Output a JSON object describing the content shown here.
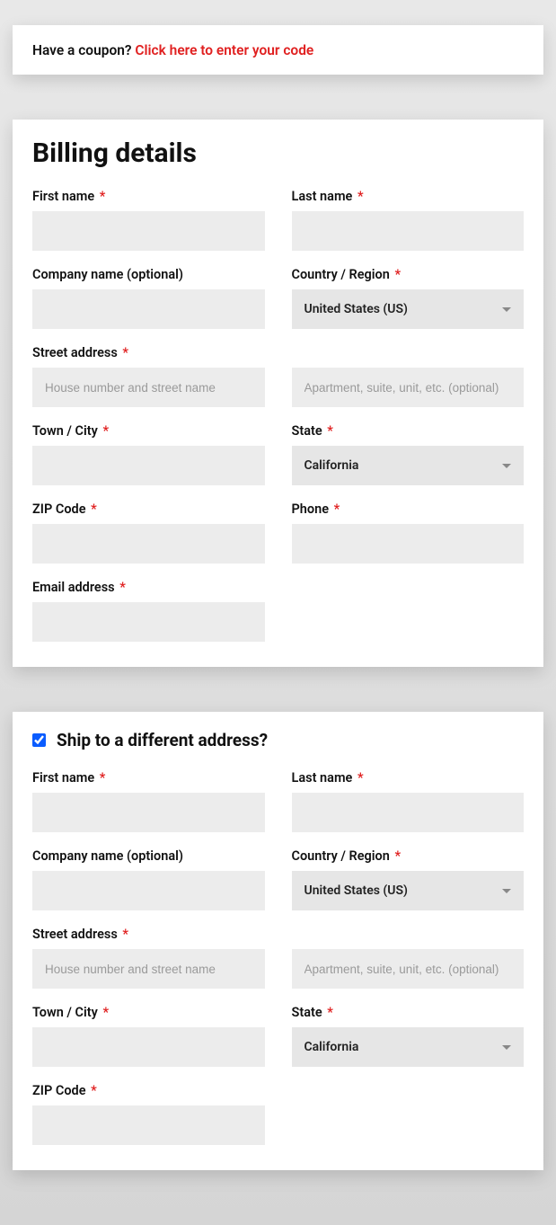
{
  "coupon": {
    "prompt": "Have a coupon? ",
    "link": "Click here to enter your code"
  },
  "billing": {
    "heading": "Billing details",
    "first_name_label": "First name",
    "last_name_label": "Last name",
    "company_label": "Company name (optional)",
    "country_label": "Country / Region",
    "country_value": "United States (US)",
    "street_label": "Street address",
    "street_ph1": "House number and street name",
    "street_ph2": "Apartment, suite, unit, etc. (optional)",
    "city_label": "Town / City",
    "state_label": "State",
    "state_value": "California",
    "zip_label": "ZIP Code",
    "phone_label": "Phone",
    "email_label": "Email address"
  },
  "shipping": {
    "heading": "Ship to a different address?",
    "checked": true,
    "first_name_label": "First name",
    "last_name_label": "Last name",
    "company_label": "Company name (optional)",
    "country_label": "Country / Region",
    "country_value": "United States (US)",
    "street_label": "Street address",
    "street_ph1": "House number and street name",
    "street_ph2": "Apartment, suite, unit, etc. (optional)",
    "city_label": "Town / City",
    "state_label": "State",
    "state_value": "California",
    "zip_label": "ZIP Code"
  },
  "req": "*"
}
